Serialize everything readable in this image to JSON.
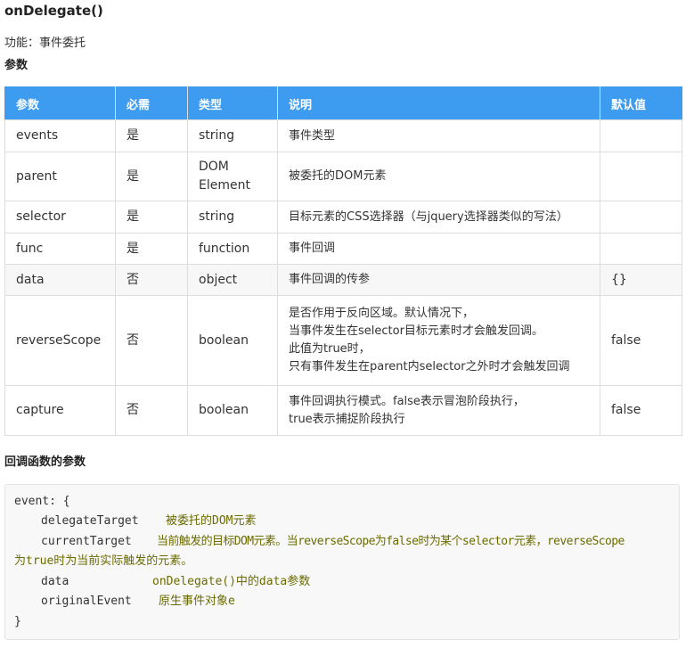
{
  "heading": "onDelegate()",
  "intro": "功能：事件委托",
  "params_label": "参数",
  "table": {
    "headers": [
      "参数",
      "必需",
      "类型",
      "说明",
      "默认值"
    ],
    "rows": [
      {
        "name": "events",
        "required": "是",
        "type": "string",
        "desc": [
          "事件类型"
        ],
        "default": ""
      },
      {
        "name": "parent",
        "required": "是",
        "type": "DOM Element",
        "desc": [
          "被委托的DOM元素"
        ],
        "default": ""
      },
      {
        "name": "selector",
        "required": "是",
        "type": "string",
        "desc": [
          "目标元素的CSS选择器（与jquery选择器类似的写法）"
        ],
        "default": ""
      },
      {
        "name": "func",
        "required": "是",
        "type": "function",
        "desc": [
          "事件回调"
        ],
        "default": ""
      },
      {
        "name": "data",
        "required": "否",
        "type": "object",
        "desc": [
          "事件回调的传参"
        ],
        "default": "{}"
      },
      {
        "name": "reverseScope",
        "required": "否",
        "type": "boolean",
        "desc": [
          "是否作用于反向区域。默认情况下，",
          "当事件发生在selector目标元素时才会触发回调。",
          "此值为true时，",
          "只有事件发生在parent内selector之外时才会触发回调"
        ],
        "default": "false"
      },
      {
        "name": "capture",
        "required": "否",
        "type": "boolean",
        "desc": [
          "事件回调执行模式。false表示冒泡阶段执行，",
          "true表示捕捉阶段执行"
        ],
        "default": "false"
      }
    ]
  },
  "callback_title": "回调函数的参数",
  "code": {
    "open": "event: {",
    "lines": [
      {
        "key": "delegateTarget",
        "comment": "被委托的DOM元素"
      },
      {
        "key": "currentTarget",
        "comment": "当前触发的目标DOM元素。当reverseScope为false时为某个selector元素，reverseScope"
      },
      {
        "key": "",
        "comment": "为true时为当前实际触发的元素。"
      },
      {
        "key": "data",
        "comment": "onDelegate()中的data参数"
      },
      {
        "key": "originalEvent",
        "comment": "原生事件对象e"
      }
    ],
    "close": "}"
  }
}
